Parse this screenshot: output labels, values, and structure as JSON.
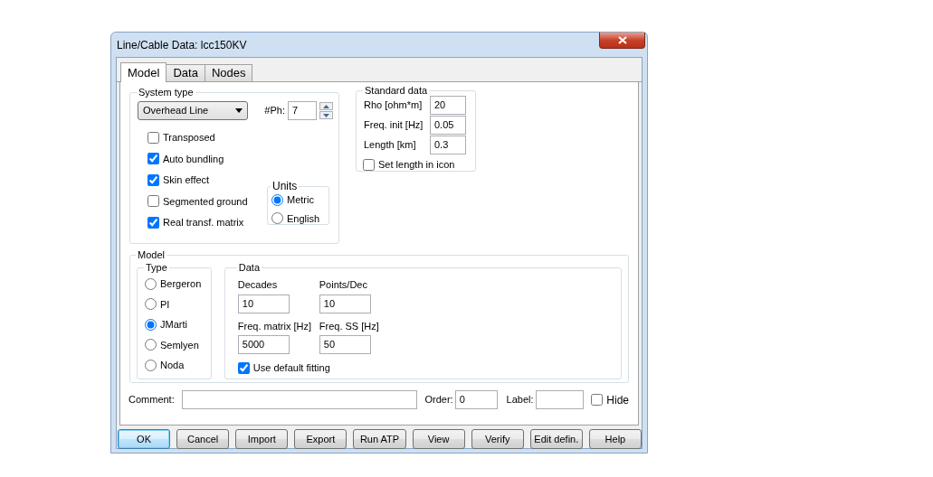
{
  "window": {
    "title": "Line/Cable Data: lcc150KV"
  },
  "tabs": [
    {
      "label": "Model",
      "selected": true
    },
    {
      "label": "Data",
      "selected": false
    },
    {
      "label": "Nodes",
      "selected": false
    }
  ],
  "system_type": {
    "legend": "System type",
    "type": "Overhead Line",
    "phases_label": "#Ph:",
    "phases": "7",
    "options": [
      {
        "label": "Transposed",
        "checked": false
      },
      {
        "label": "Auto bundling",
        "checked": true
      },
      {
        "label": "Skin effect",
        "checked": true
      },
      {
        "label": "Segmented ground",
        "checked": false
      },
      {
        "label": "Real transf. matrix",
        "checked": true
      }
    ],
    "units": {
      "legend": "Units",
      "options": [
        {
          "label": "Metric",
          "selected": true
        },
        {
          "label": "English",
          "selected": false
        }
      ]
    }
  },
  "standard_data": {
    "legend": "Standard data",
    "fields": [
      {
        "label": "Rho [ohm*m]",
        "value": "20"
      },
      {
        "label": "Freq. init [Hz]",
        "value": "0.05"
      },
      {
        "label": "Length [km]",
        "value": "0.3"
      }
    ],
    "set_length": {
      "label": "Set length in icon",
      "checked": false
    }
  },
  "model": {
    "legend": "Model",
    "type": {
      "legend": "Type",
      "options": [
        {
          "label": "Bergeron",
          "selected": false
        },
        {
          "label": "PI",
          "selected": false
        },
        {
          "label": "JMarti",
          "selected": true
        },
        {
          "label": "Semlyen",
          "selected": false
        },
        {
          "label": "Noda",
          "selected": false
        }
      ]
    },
    "data": {
      "legend": "Data",
      "fields": [
        {
          "label": "Decades",
          "value": "10"
        },
        {
          "label": "Points/Dec",
          "value": "10"
        },
        {
          "label": "Freq. matrix [Hz]",
          "value": "5000"
        },
        {
          "label": "Freq. SS [Hz]",
          "value": "50"
        }
      ],
      "use_default_fitting": {
        "label": "Use default fitting",
        "checked": true
      }
    }
  },
  "comment": {
    "label": "Comment:"
  },
  "order": {
    "label": "Order:",
    "value": "0"
  },
  "label_field": {
    "label": "Label:"
  },
  "hide": {
    "label": "Hide",
    "checked": false
  },
  "buttons": [
    {
      "label": "OK",
      "default": true
    },
    {
      "label": "Cancel",
      "default": false
    },
    {
      "label": "Import",
      "default": false
    },
    {
      "label": "Export",
      "default": false
    },
    {
      "label": "Run ATP",
      "default": false
    },
    {
      "label": "View",
      "default": false
    },
    {
      "label": "Verify",
      "default": false
    },
    {
      "label": "Edit defin.",
      "default": false
    },
    {
      "label": "Help",
      "default": false
    }
  ]
}
